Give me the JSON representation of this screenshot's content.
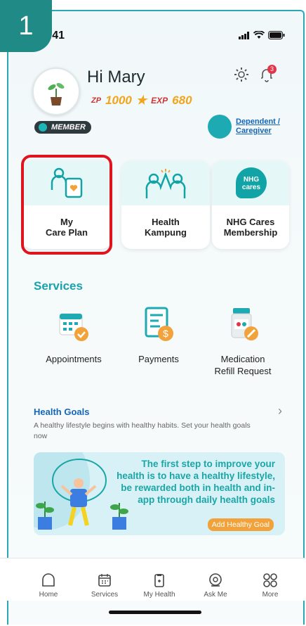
{
  "step_badge": "1",
  "status": {
    "time": "9:41"
  },
  "profile": {
    "greeting": "Hi Mary",
    "zp_label": "ZP",
    "zp_value": "1000",
    "exp_label": "EXP",
    "exp_value": "680",
    "member_badge": "MEMBER",
    "dependent_link_line1": "Dependent /",
    "dependent_link_line2": "Caregiver",
    "notification_count": "3"
  },
  "quick_cards": [
    {
      "label1": "My",
      "label2": "Care Plan"
    },
    {
      "label1": "Health",
      "label2": "Kampung"
    },
    {
      "label1": "NHG Cares",
      "label2": "Membership",
      "logo_text": "NHG cares"
    }
  ],
  "services": {
    "title": "Services",
    "items": [
      {
        "line1": "Appointments",
        "line2": ""
      },
      {
        "line1": "Payments",
        "line2": ""
      },
      {
        "line1": "Medication",
        "line2": "Refill Request"
      }
    ]
  },
  "health_goals": {
    "title": "Health Goals",
    "desc": "A healthy lifestyle begins with healthy habits. Set your health goals now"
  },
  "banner": {
    "text": "The first step to improve your health is to have a healthy lifestyle, be rewarded both in health and in-app through daily health goals",
    "button": "Add Healthy Goal"
  },
  "tabs": [
    {
      "label": "Home"
    },
    {
      "label": "Services"
    },
    {
      "label": "My Health"
    },
    {
      "label": "Ask Me"
    },
    {
      "label": "More"
    }
  ],
  "colors": {
    "accent": "#1aa6a6",
    "highlight": "#e0141e",
    "link": "#1565b8",
    "points": "#f2a51a"
  }
}
